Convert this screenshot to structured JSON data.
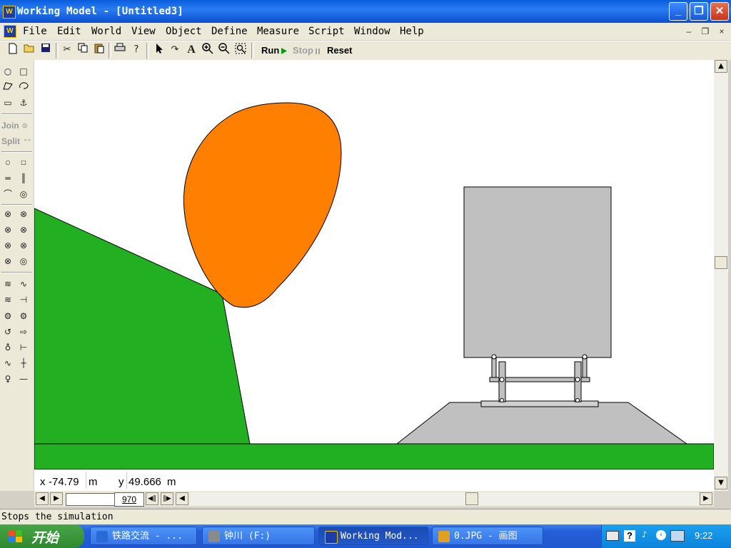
{
  "window": {
    "title": "Working Model - [Untitled3]",
    "app_icon_text": "W",
    "minimize_glyph": "_",
    "maximize_glyph": "❐",
    "close_glyph": "✕"
  },
  "menu": {
    "items": [
      "File",
      "Edit",
      "World",
      "View",
      "Object",
      "Define",
      "Measure",
      "Script",
      "Window",
      "Help"
    ],
    "mdi_minimize": "–",
    "mdi_restore": "❐",
    "mdi_close": "×"
  },
  "toolbar": {
    "run_label": "Run",
    "stop_label": "Stop",
    "reset_label": "Reset",
    "text_tool_glyph": "A"
  },
  "palette": {
    "join_label": "Join",
    "split_label": "Split"
  },
  "coords": {
    "x_label": "x",
    "x_value": "-74.79",
    "x_unit": "m",
    "y_label": "y",
    "y_value": "49.666",
    "y_unit": "m"
  },
  "playback": {
    "frame": "970"
  },
  "status": {
    "text": "Stops the simulation"
  },
  "taskbar": {
    "start_label": "开始",
    "tasks": [
      {
        "label": "铁路交流 - ...",
        "icon_color": "#2a6ad8"
      },
      {
        "label": "钟川 (F:)",
        "icon_color": "#8a8a8a"
      },
      {
        "label": "Working Mod...",
        "icon_color": "#1a3ea8",
        "active": true
      },
      {
        "label": "0.JPG - 画图",
        "icon_color": "#e0a020"
      }
    ],
    "clock": "9:22"
  },
  "colors": {
    "ground": "#22b022",
    "boulder": "#ff8000",
    "vehicle": "#c0c0c0",
    "embankment": "#c0c0c0"
  }
}
